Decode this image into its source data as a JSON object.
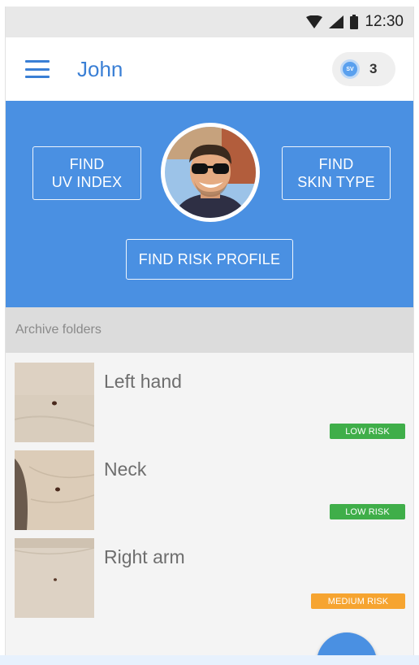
{
  "status_bar": {
    "time": "12:30",
    "icons": [
      "wifi-icon",
      "signal-icon",
      "battery-icon"
    ]
  },
  "app_bar": {
    "title": "John",
    "coin_icon_text": "SV",
    "coin_count": "3",
    "menu_icon": "hamburger-menu-icon"
  },
  "hero": {
    "uv_button_line1": "FIND",
    "uv_button_line2": "UV INDEX",
    "skin_button_line1": "FIND",
    "skin_button_line2": "SKIN TYPE",
    "risk_button": "FIND RISK PROFILE"
  },
  "archive": {
    "header": "Archive folders",
    "items": [
      {
        "title": "Left hand",
        "risk": "LOW RISK",
        "risk_level": "low"
      },
      {
        "title": "Neck",
        "risk": "LOW RISK",
        "risk_level": "low"
      },
      {
        "title": "Right arm",
        "risk": "MEDIUM RISK",
        "risk_level": "medium"
      }
    ]
  },
  "colors": {
    "primary_blue": "#4a90e2",
    "title_blue": "#3a7fd5",
    "low_risk_green": "#3fae49",
    "medium_risk_orange": "#f6a430"
  }
}
